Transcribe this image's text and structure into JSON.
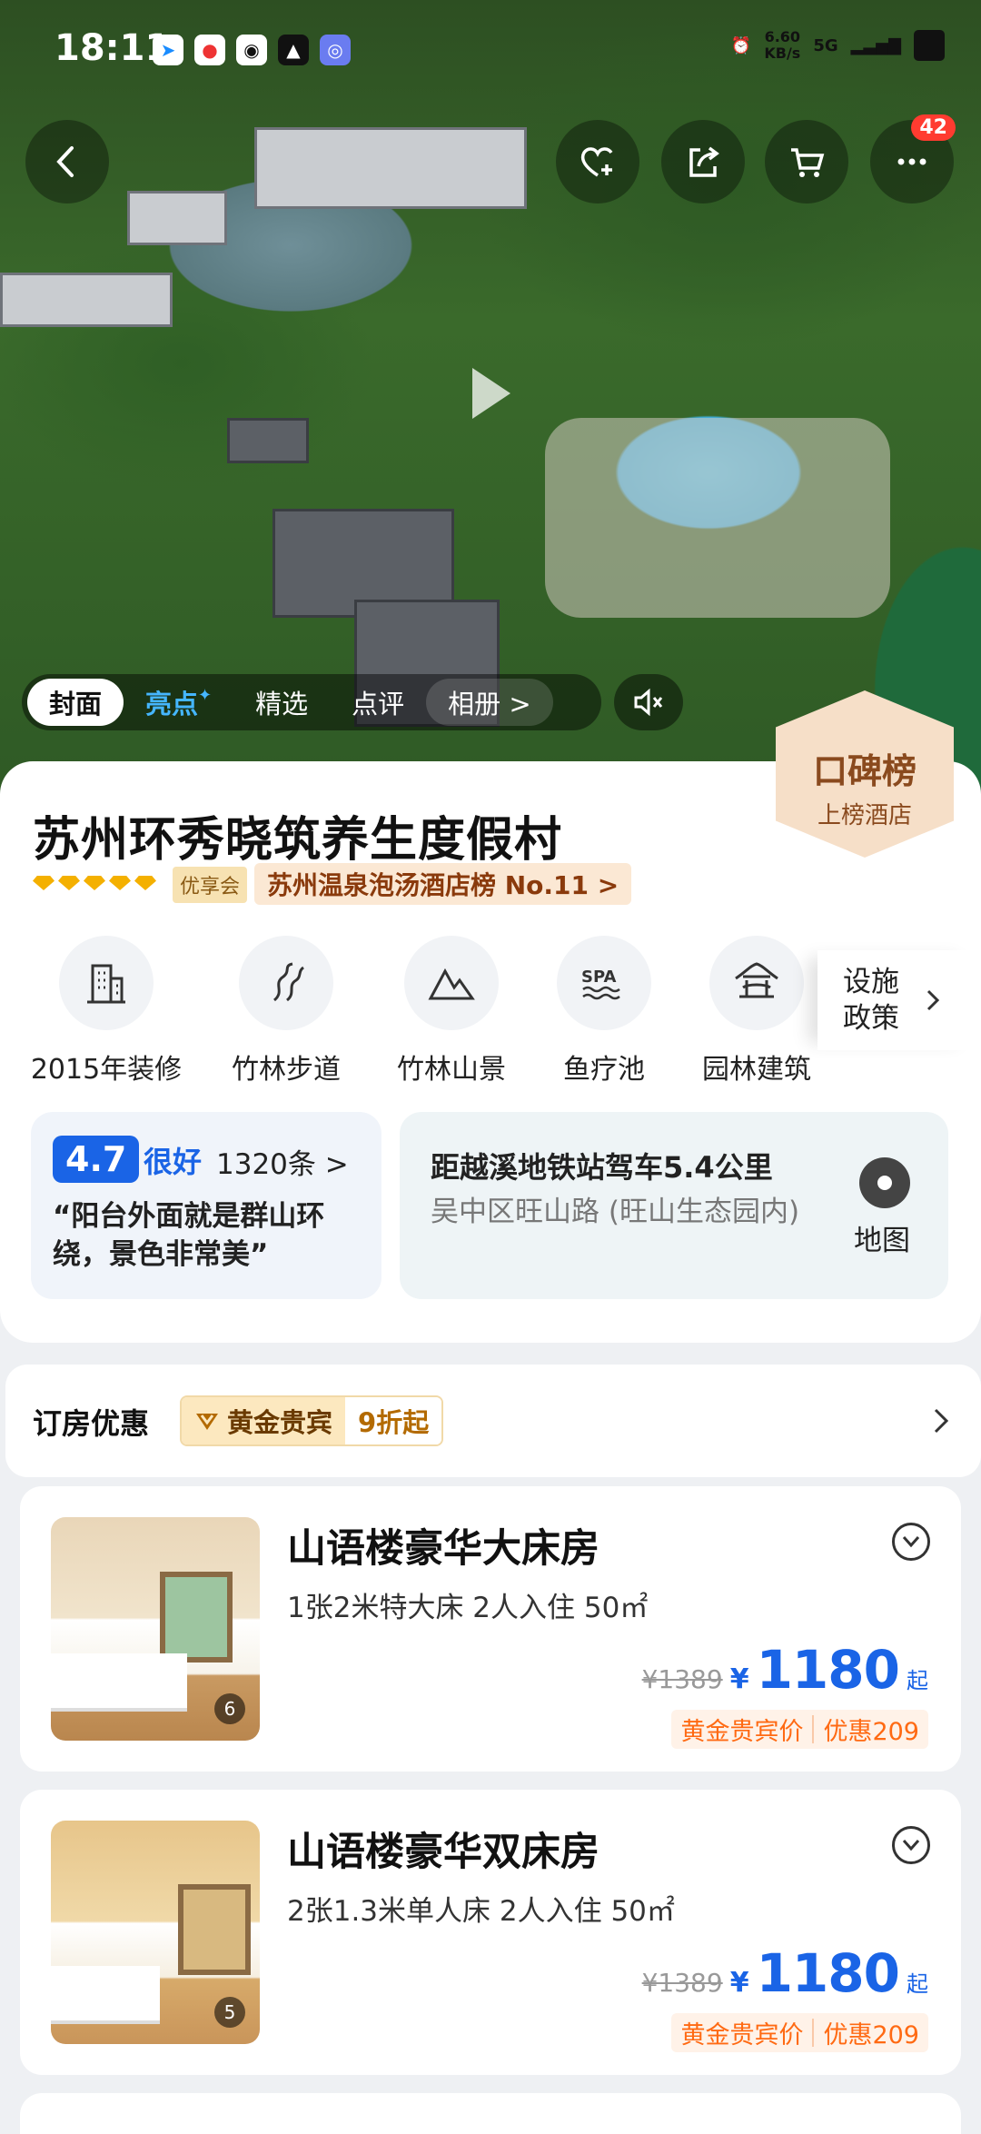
{
  "status_bar": {
    "time": "18:11",
    "network_speed": "6.60\nKB/s",
    "network": "5G",
    "app_icons": [
      "telegram-icon",
      "note-icon",
      "qq-icon",
      "navigation-icon",
      "browser-icon"
    ]
  },
  "top_actions": {
    "cart_badge": "42"
  },
  "media_tabs": [
    {
      "label": "封面",
      "active": true
    },
    {
      "label": "亮点",
      "highlight": true
    },
    {
      "label": "精选"
    },
    {
      "label": "点评"
    },
    {
      "label": "相册 >"
    }
  ],
  "koubei": {
    "brand": "口碑榜",
    "sub": "上榜酒店"
  },
  "hotel": {
    "name": "苏州环秀晓筑养生度假村",
    "member_tag": "优享会",
    "rank_text": "苏州温泉泡汤酒店榜 No.11 >"
  },
  "facilities": [
    {
      "label": "2015年装修",
      "icon": "building-icon"
    },
    {
      "label": "竹林步道",
      "icon": "trail-icon"
    },
    {
      "label": "竹林山景",
      "icon": "mountain-icon"
    },
    {
      "label": "鱼疗池",
      "icon": "spa-icon"
    },
    {
      "label": "园林建筑",
      "icon": "pavilion-icon"
    }
  ],
  "policy": {
    "label_line1": "设施",
    "label_line2": "政策"
  },
  "review": {
    "score": "4.7",
    "level": "很好",
    "count": "1320条 >",
    "quote": "“阳台外面就是群山环绕，景色非常美”"
  },
  "location": {
    "distance": "距越溪地铁站驾车5.4公里",
    "address": "吴中区旺山路 (旺山生态园内)",
    "map_label": "地图"
  },
  "promo": {
    "title": "订房优惠",
    "vip_label": "黄金贵宾",
    "vip_discount": "9折起"
  },
  "rooms": [
    {
      "name": "山语楼豪华大床房",
      "info": "1张2米特大床  2人入住  50㎡",
      "photo_count": "6",
      "orig_price": "¥1389",
      "currency": "¥",
      "price": "1180",
      "suffix": "起",
      "vip_tag": "黄金贵宾价",
      "discount": "优惠209"
    },
    {
      "name": "山语楼豪华双床房",
      "info": "2张1.3米单人床  2人入住  50㎡",
      "photo_count": "5",
      "orig_price": "¥1389",
      "currency": "¥",
      "price": "1180",
      "suffix": "起",
      "vip_tag": "黄金贵宾价",
      "discount": "优惠209"
    }
  ],
  "colors": {
    "primary_blue": "#1a64e6",
    "orange": "#ff6a13",
    "gold": "#f4b000"
  }
}
